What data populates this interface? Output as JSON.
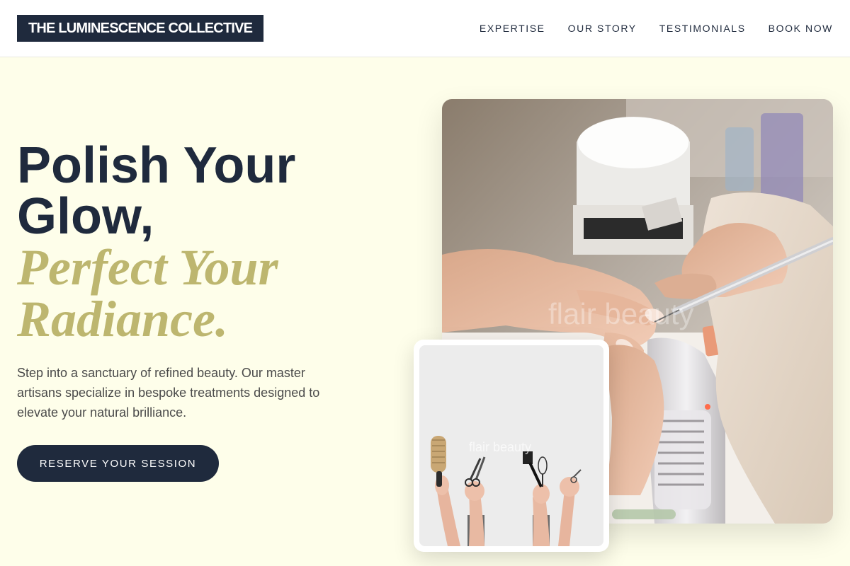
{
  "header": {
    "logo_text": "THE LUMINESCENCE COLLECTIVE",
    "nav": [
      "EXPERTISE",
      "OUR STORY",
      "TESTIMONIALS",
      "BOOK NOW"
    ]
  },
  "hero": {
    "title_line1": "Polish Your Glow,",
    "title_line2": "Perfect Your Radiance.",
    "description": "Step into a sanctuary of refined beauty. Our master artisans specialize in bespoke treatments designed to elevate your natural brilliance.",
    "cta_label": "RESERVE YOUR SESSION"
  },
  "images": {
    "main_watermark": "flair beauty",
    "small_watermark": "flair beauty"
  },
  "colors": {
    "navy": "#1f2a3d",
    "gold": "#bdb66f",
    "cream_background": "#fefeea"
  }
}
